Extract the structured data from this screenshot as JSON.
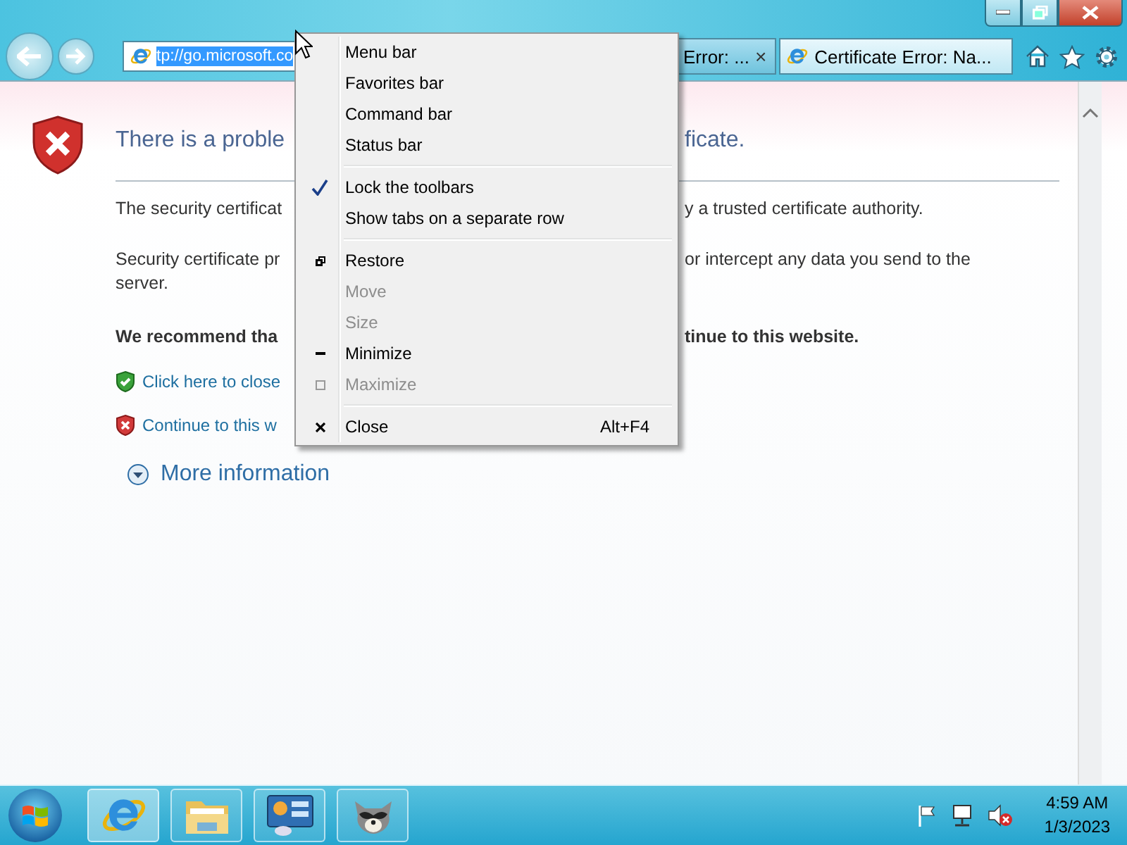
{
  "browser": {
    "address": "tp://go.microsoft.co",
    "tabs": [
      {
        "title": "Error: ...",
        "selected": false,
        "close": "×"
      },
      {
        "title": "Certificate Error: Na...",
        "selected": true
      }
    ]
  },
  "page": {
    "heading": [
      "There is a proble",
      "ficate."
    ],
    "paragraphs": [
      {
        "kind": "split",
        "parts": [
          "The security certificat",
          "y a trusted certificate authority."
        ]
      },
      {
        "kind": "split2",
        "parts": [
          "Security certificate pr",
          "or intercept any data you send to the",
          "server."
        ]
      },
      {
        "kind": "bold",
        "parts": [
          "We recommend tha",
          "tinue to this website."
        ]
      }
    ],
    "links": [
      {
        "kind": "safe",
        "label": "Click here to close"
      },
      {
        "kind": "danger",
        "label": "Continue to this w"
      }
    ],
    "more": "More information"
  },
  "context_menu": {
    "groups": [
      [
        {
          "kind": "toggle",
          "label": "Menu bar",
          "checked": false
        },
        {
          "kind": "toggle",
          "label": "Favorites bar",
          "checked": false
        },
        {
          "kind": "toggle",
          "label": "Command bar",
          "checked": false
        },
        {
          "kind": "toggle",
          "label": "Status bar",
          "checked": false
        }
      ],
      [
        {
          "kind": "toggle",
          "label": "Lock the toolbars",
          "checked": true
        },
        {
          "kind": "toggle",
          "label": "Show tabs on a separate row",
          "checked": false
        }
      ],
      [
        {
          "kind": "restore",
          "label": "Restore",
          "disabled": false
        },
        {
          "kind": "plain",
          "label": "Move",
          "disabled": true
        },
        {
          "kind": "plain",
          "label": "Size",
          "disabled": true
        },
        {
          "kind": "minimize",
          "label": "Minimize",
          "disabled": false
        },
        {
          "kind": "maximize",
          "label": "Maximize",
          "disabled": true
        }
      ],
      [
        {
          "kind": "close",
          "label": "Close",
          "disabled": false,
          "shortcut": "Alt+F4"
        }
      ]
    ]
  },
  "taskbar": {
    "apps": [
      {
        "kind": "ie",
        "selected": true
      },
      {
        "kind": "folder",
        "selected": false
      },
      {
        "kind": "panel",
        "selected": false
      },
      {
        "kind": "raccoon",
        "selected": false
      }
    ],
    "clock": {
      "time": "4:59 AM",
      "date": "1/3/2023"
    }
  }
}
